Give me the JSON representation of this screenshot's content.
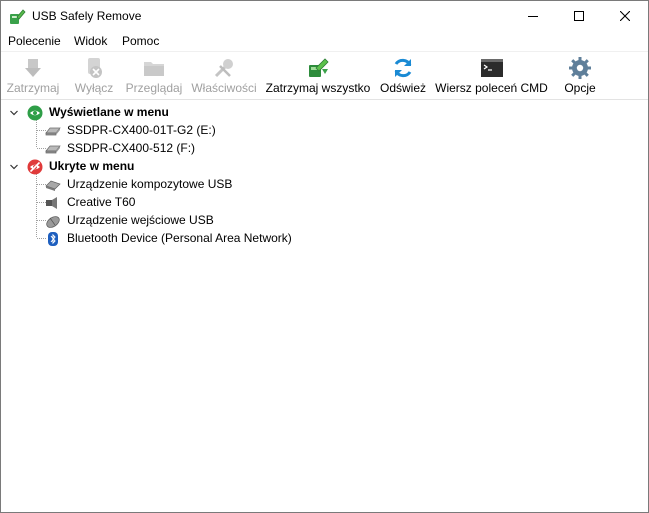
{
  "window": {
    "title": "USB Safely Remove"
  },
  "menu": {
    "items": [
      {
        "label": "Polecenie"
      },
      {
        "label": "Widok"
      },
      {
        "label": "Pomoc"
      }
    ]
  },
  "toolbar": {
    "buttons": [
      {
        "label": "Zatrzymaj",
        "icon": "usb-stop-icon",
        "enabled": false
      },
      {
        "label": "Wyłącz",
        "icon": "power-off-icon",
        "enabled": false
      },
      {
        "label": "Przeglądaj",
        "icon": "folder-icon",
        "enabled": false
      },
      {
        "label": "Właściwości",
        "icon": "tools-icon",
        "enabled": false
      },
      {
        "label": "Zatrzymaj wszystko",
        "icon": "stop-all-icon",
        "enabled": true
      },
      {
        "label": "Odśwież",
        "icon": "refresh-icon",
        "enabled": true
      },
      {
        "label": "Wiersz poleceń CMD",
        "icon": "cmd-icon",
        "enabled": true
      },
      {
        "label": "Opcje",
        "icon": "gear-icon",
        "enabled": true
      }
    ]
  },
  "tree": {
    "shown_group": {
      "label": "Wyświetlane w menu",
      "icon": "eye-icon",
      "color": "#2e9e47",
      "items": [
        {
          "label": "SSDPR-CX400-01T-G2 (E:)",
          "icon": "drive-icon"
        },
        {
          "label": "SSDPR-CX400-512 (F:)",
          "icon": "drive-icon"
        }
      ]
    },
    "hidden_group": {
      "label": "Ukryte w menu",
      "icon": "eye-hidden-icon",
      "color": "#e03a3a",
      "items": [
        {
          "label": "Urządzenie kompozytowe USB",
          "icon": "usb-device-icon"
        },
        {
          "label": "Creative T60",
          "icon": "speaker-icon"
        },
        {
          "label": "Urządzenie wejściowe USB",
          "icon": "mouse-icon"
        },
        {
          "label": "Bluetooth Device (Personal Area Network)",
          "icon": "bluetooth-icon"
        }
      ]
    }
  },
  "colors": {
    "accent": "#1a8ad4",
    "disabled_text": "#a0a0a0"
  }
}
